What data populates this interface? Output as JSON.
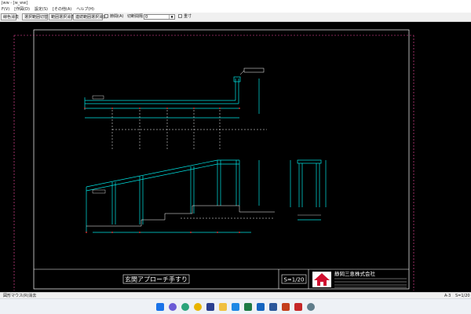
{
  "window": {
    "title": "Jww - [w_ww]"
  },
  "menu": {
    "items": [
      "F(V)",
      "[作図(D)",
      "設定(S)",
      "[その他(A)",
      "ヘルプ(H)"
    ]
  },
  "toolbar": {
    "btn1": "線色消去",
    "btn2": "選択範囲切替",
    "btn3": "範囲選択消去",
    "btn4": "連続範囲選択消去",
    "check1_label": "節間(A)",
    "select_label": "切断間隔",
    "select_value": "0",
    "check2_label": "重寸"
  },
  "drawing": {
    "title": "玄関アプローチ手すり",
    "scale": "S=1/20",
    "company": "静岡三恵株式会社"
  },
  "status": {
    "left": "図形マウス(R)消去",
    "right_sheet": "A-3",
    "right_scale": "S=1/20"
  },
  "taskbar": {
    "icons": [
      "windows-icon",
      "copilot-icon",
      "edge-icon",
      "chrome-icon",
      "jw-icon",
      "explorer-icon",
      "store-icon",
      "excel-icon",
      "outlook-icon",
      "word-icon",
      "powerpoint-icon",
      "cad-icon",
      "settings-icon"
    ]
  }
}
